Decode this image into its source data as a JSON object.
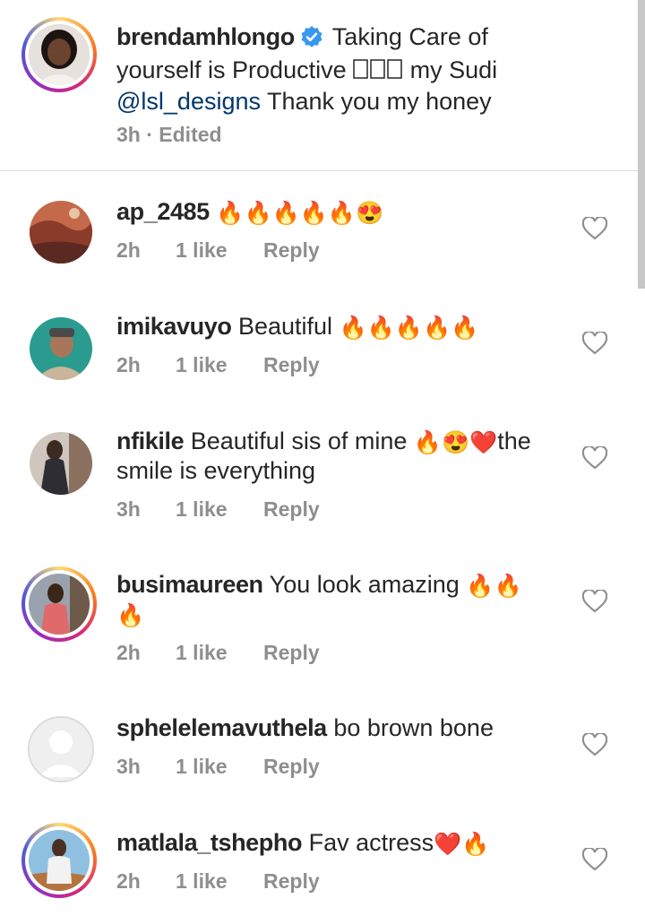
{
  "caption": {
    "username": "brendamhlongo",
    "text_1": "Taking Care of",
    "text_2": "yourself is Productive",
    "text_3": "my Sudi",
    "mention": "@lsl_designs",
    "text_4": "Thank you my honey",
    "time": "3h",
    "edited": "Edited",
    "separator": "·"
  },
  "comments": [
    {
      "username": "ap_2485",
      "text": "",
      "emojis": "🔥🔥🔥🔥🔥😍",
      "time": "2h",
      "likes": "1 like",
      "reply": "Reply"
    },
    {
      "username": "imikavuyo",
      "text": "Beautiful",
      "emojis": "🔥🔥🔥🔥🔥",
      "time": "2h",
      "likes": "1 like",
      "reply": "Reply"
    },
    {
      "username": "nfikile",
      "text": "Beautiful sis of mine",
      "emojis": "🔥😍❤️",
      "text_after": "the",
      "line2": "smile is everything",
      "time": "3h",
      "likes": "1 like",
      "reply": "Reply"
    },
    {
      "username": "busimaureen",
      "text": "You look  amazing",
      "emojis": "🔥🔥",
      "line2": "🔥",
      "time": "2h",
      "likes": "1 like",
      "reply": "Reply"
    },
    {
      "username": "sphelelemavuthela",
      "text": "bo brown bone",
      "time": "3h",
      "likes": "1 like",
      "reply": "Reply"
    },
    {
      "username": "matlala_tshepho",
      "text": "Fav actress",
      "emojis": "❤️🔥",
      "time": "2h",
      "likes": "1 like",
      "reply": "Reply"
    }
  ],
  "colors": {
    "accent_link": "#00376b",
    "verified": "#3897f0",
    "meta": "#8e8e8e",
    "heart_outline": "#8e8e8e"
  },
  "icons": {
    "verified": "verified-badge-icon",
    "like": "heart-outline-icon"
  }
}
